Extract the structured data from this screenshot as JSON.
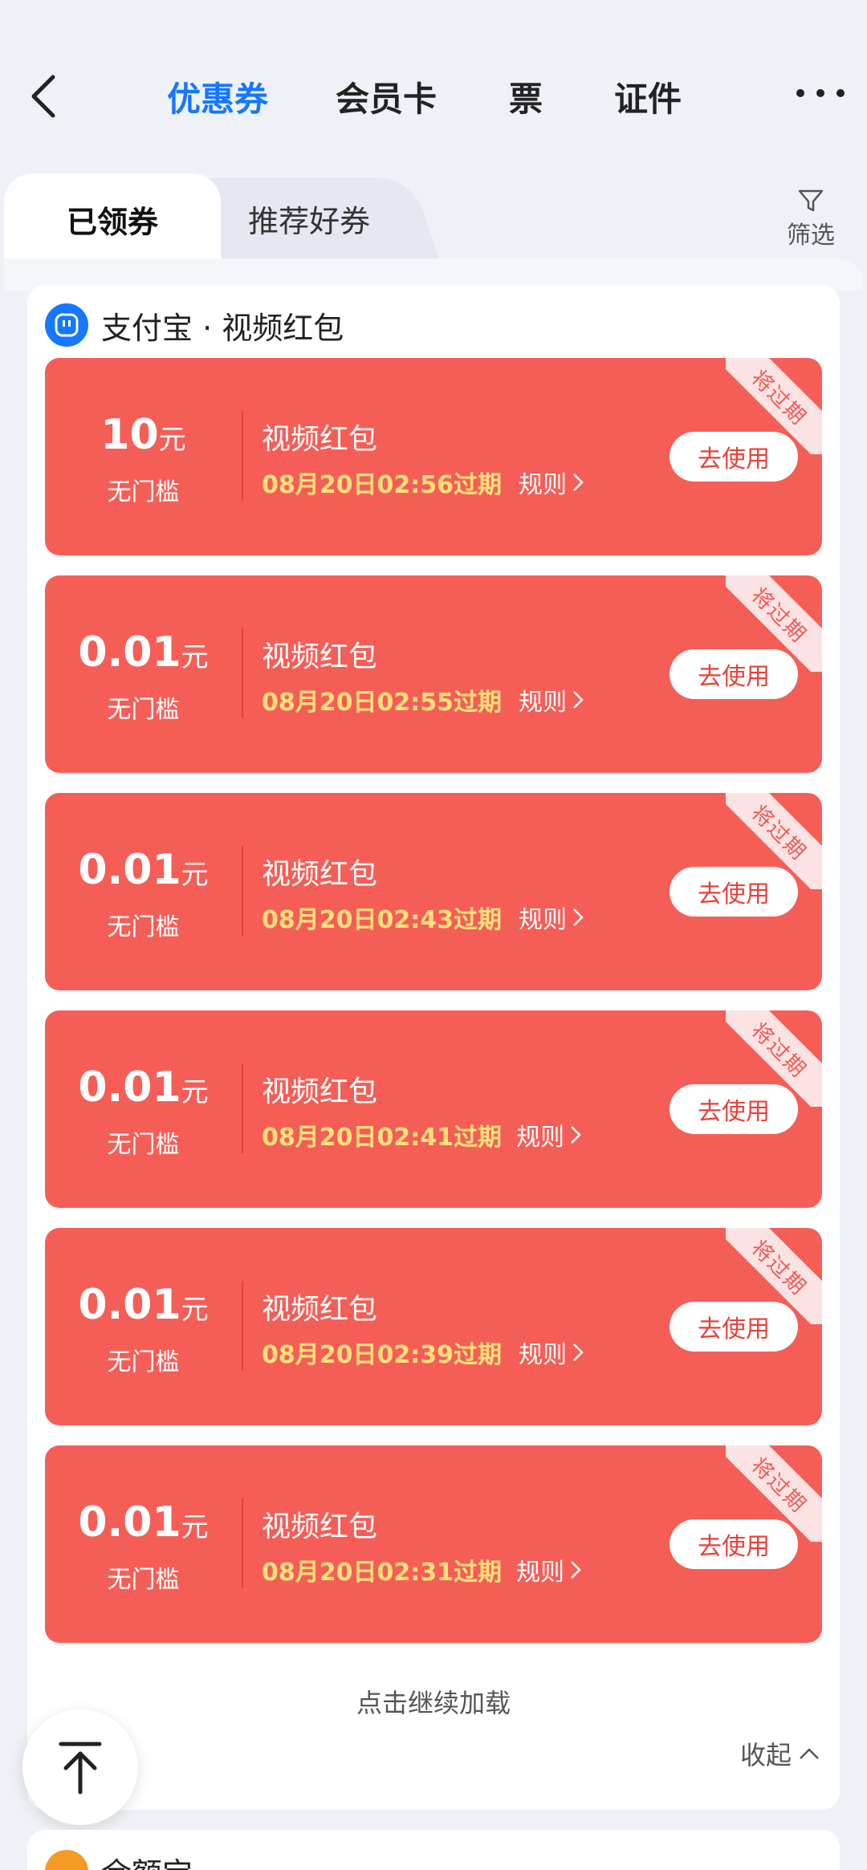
{
  "nav": {
    "tabs": [
      {
        "label": "优惠券",
        "active": true
      },
      {
        "label": "会员卡",
        "active": false
      },
      {
        "label": "票",
        "active": false
      },
      {
        "label": "证件",
        "active": false
      }
    ]
  },
  "subtabs": {
    "received": "已领券",
    "recommended": "推荐好券",
    "filter_label": "筛选"
  },
  "group": {
    "title": "支付宝 · 视频红包",
    "coupons": [
      {
        "amount": "10",
        "unit": "元",
        "threshold": "无门槛",
        "name": "视频红包",
        "expiry": "08月20日02:56过期",
        "rule": "规则",
        "action": "去使用",
        "badge": "将过期"
      },
      {
        "amount": "0.01",
        "unit": "元",
        "threshold": "无门槛",
        "name": "视频红包",
        "expiry": "08月20日02:55过期",
        "rule": "规则",
        "action": "去使用",
        "badge": "将过期"
      },
      {
        "amount": "0.01",
        "unit": "元",
        "threshold": "无门槛",
        "name": "视频红包",
        "expiry": "08月20日02:43过期",
        "rule": "规则",
        "action": "去使用",
        "badge": "将过期"
      },
      {
        "amount": "0.01",
        "unit": "元",
        "threshold": "无门槛",
        "name": "视频红包",
        "expiry": "08月20日02:41过期",
        "rule": "规则",
        "action": "去使用",
        "badge": "将过期"
      },
      {
        "amount": "0.01",
        "unit": "元",
        "threshold": "无门槛",
        "name": "视频红包",
        "expiry": "08月20日02:39过期",
        "rule": "规则",
        "action": "去使用",
        "badge": "将过期"
      },
      {
        "amount": "0.01",
        "unit": "元",
        "threshold": "无门槛",
        "name": "视频红包",
        "expiry": "08月20日02:31过期",
        "rule": "规则",
        "action": "去使用",
        "badge": "将过期"
      }
    ],
    "load_more": "点击继续加载",
    "collapse": "收起"
  },
  "next_group": {
    "title": "余额宝"
  },
  "colors": {
    "accent": "#1677ff",
    "coupon_bg": "#f55e57",
    "expiry_text": "#ffe07a"
  }
}
